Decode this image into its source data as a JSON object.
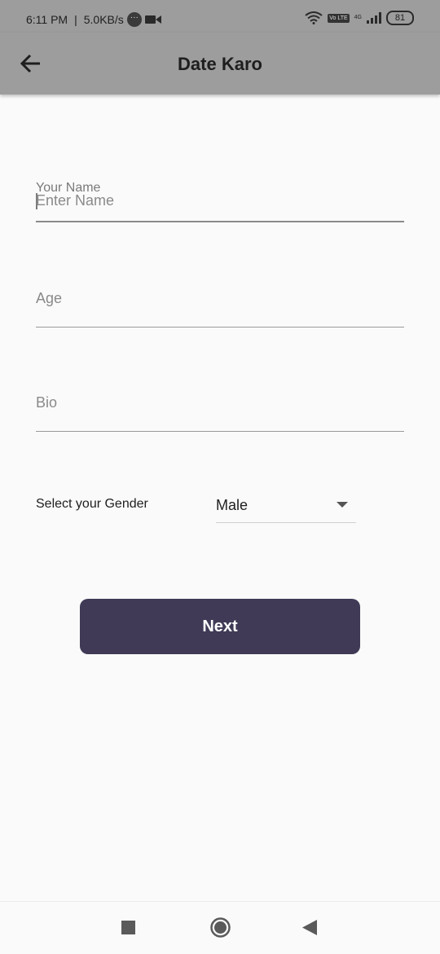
{
  "status_bar": {
    "time": "6:11 PM",
    "speed": "5.0KB/s",
    "chat_icon": "chat-bubble-icon",
    "video_icon": "video-camera-icon",
    "wifi_icon": "wifi-icon",
    "volte_badge": "Vo LTE",
    "network_badge": "4G",
    "signal_icon": "signal-bars-icon",
    "battery": "81"
  },
  "app_bar": {
    "title": "Date Karo",
    "back_icon": "arrow-back-icon"
  },
  "form": {
    "name": {
      "label": "Your Name",
      "placeholder": "Enter Name",
      "value": ""
    },
    "age": {
      "placeholder": "Age",
      "value": ""
    },
    "bio": {
      "placeholder": "Bio",
      "value": ""
    },
    "gender": {
      "label": "Select your Gender",
      "selected": "Male",
      "icon": "dropdown-arrow-icon"
    }
  },
  "next_button": {
    "label": "Next"
  },
  "nav_bar": {
    "recents_icon": "square-icon",
    "home_icon": "circle-icon",
    "back_icon": "triangle-back-icon"
  },
  "colors": {
    "app_bar_bg": "#9c9d9c",
    "page_bg": "#f9faf9",
    "button_bg": "#403a56",
    "button_text": "#ffffff",
    "underline_focused": "#8a8a8a",
    "underline": "#9a9a9a"
  }
}
